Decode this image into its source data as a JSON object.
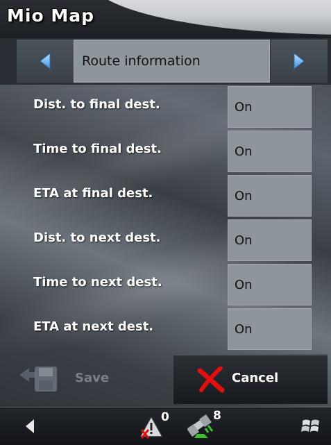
{
  "app": {
    "title": "Mio Map"
  },
  "nav": {
    "title": "Route information",
    "prev_icon": "arrow-left-icon",
    "next_icon": "arrow-right-icon"
  },
  "settings": [
    {
      "label": "Dist. to final dest.",
      "value": "On"
    },
    {
      "label": "Time to final dest.",
      "value": "On"
    },
    {
      "label": "ETA at final dest.",
      "value": "On"
    },
    {
      "label": "Dist. to next dest.",
      "value": "On"
    },
    {
      "label": "Time to next dest.",
      "value": "On"
    },
    {
      "label": "ETA at next dest.",
      "value": "On"
    }
  ],
  "actions": {
    "save_label": "Save",
    "cancel_label": "Cancel"
  },
  "taskbar": {
    "warning_count": "0",
    "satellite_count": "8"
  },
  "colors": {
    "value_box": "#8f959c",
    "cancel_x": "#e01010"
  }
}
